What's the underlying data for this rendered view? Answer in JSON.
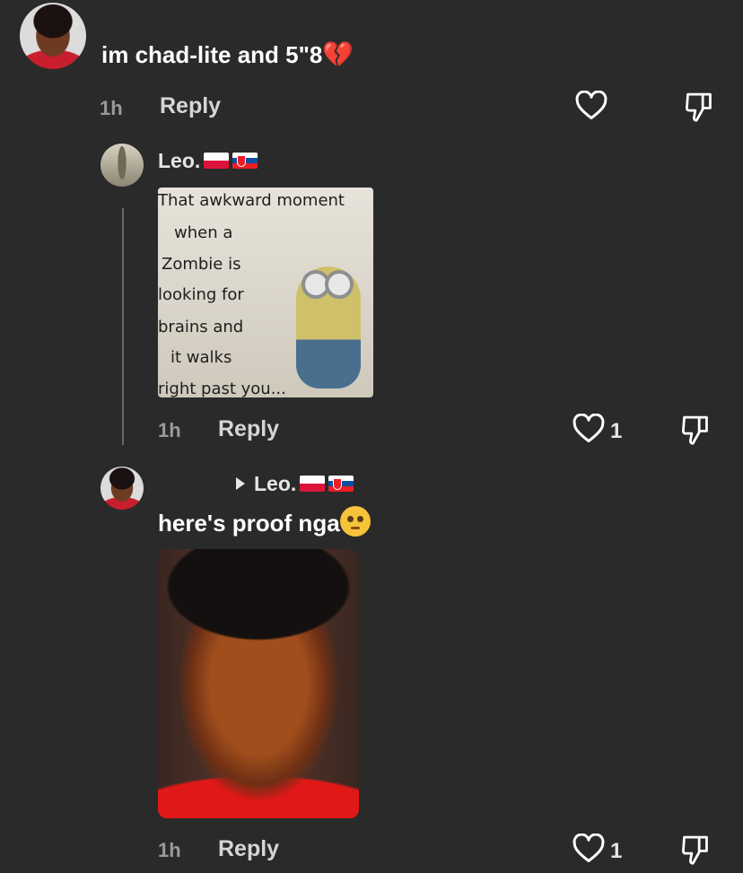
{
  "comments": [
    {
      "text": "im chad-lite and 5\"8",
      "emoji": "💔",
      "time": "1h",
      "reply_label": "Reply",
      "likes": ""
    }
  ],
  "replies": [
    {
      "username": "Leo.",
      "meme_lines": [
        "That awkward moment",
        "when a",
        "Zombie is",
        "looking for",
        "brains and",
        "it walks",
        "right past you..."
      ],
      "time": "1h",
      "reply_label": "Reply",
      "likes": "1"
    },
    {
      "reply_to": "Leo.",
      "text": "here's proof nga",
      "time": "1h",
      "reply_label": "Reply",
      "likes": "1"
    }
  ],
  "icons": {
    "like": "heart-outline-icon",
    "dislike": "thumbs-down-icon",
    "reply_to_arrow": "triangle-right-icon"
  },
  "colors": {
    "background": "#2a2a2a",
    "meta": "#9a9a9a",
    "text": "#ffffff"
  }
}
